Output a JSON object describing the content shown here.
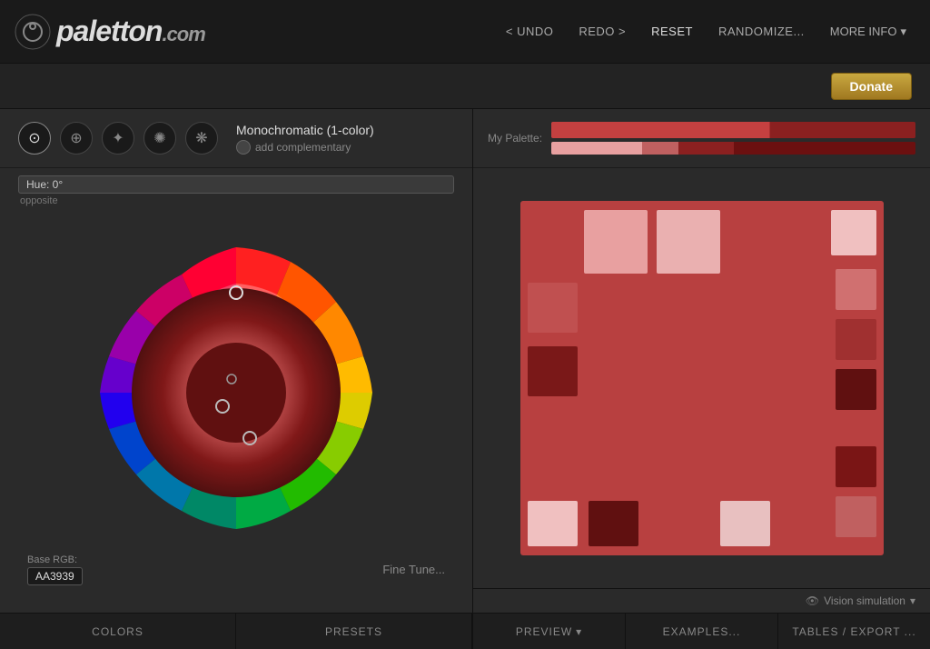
{
  "header": {
    "logo_name": "paletton",
    "logo_suffix": ".com",
    "nav": {
      "undo_label": "< UNDO",
      "redo_label": "REDO >",
      "reset_label": "RESET",
      "randomize_label": "RANDOMIZE...",
      "more_info_label": "MORE INFO"
    }
  },
  "donate_bar": {
    "donate_label": "Donate"
  },
  "left_panel": {
    "hue": {
      "badge": "Hue: 0°",
      "opposite": "opposite"
    },
    "scheme": {
      "name": "Monochromatic (1-color)",
      "add_complementary": "add complementary"
    },
    "base_rgb": {
      "label": "Base RGB:",
      "value": "AA3939"
    },
    "fine_tune": "Fine Tune...",
    "tabs": [
      {
        "label": "COLORS"
      },
      {
        "label": "PRESETS"
      }
    ]
  },
  "right_panel": {
    "palette_label": "My Palette:",
    "vision_simulation": "Vision simulation",
    "bottom_tabs": [
      {
        "label": "PREVIEW"
      },
      {
        "label": "EXAMPLES..."
      },
      {
        "label": "TABLES / EXPORT ..."
      }
    ]
  },
  "colors": {
    "accent": "#b84040",
    "light": "#e8a0a0",
    "dark": "#6b1010",
    "mid": "#c06060"
  }
}
